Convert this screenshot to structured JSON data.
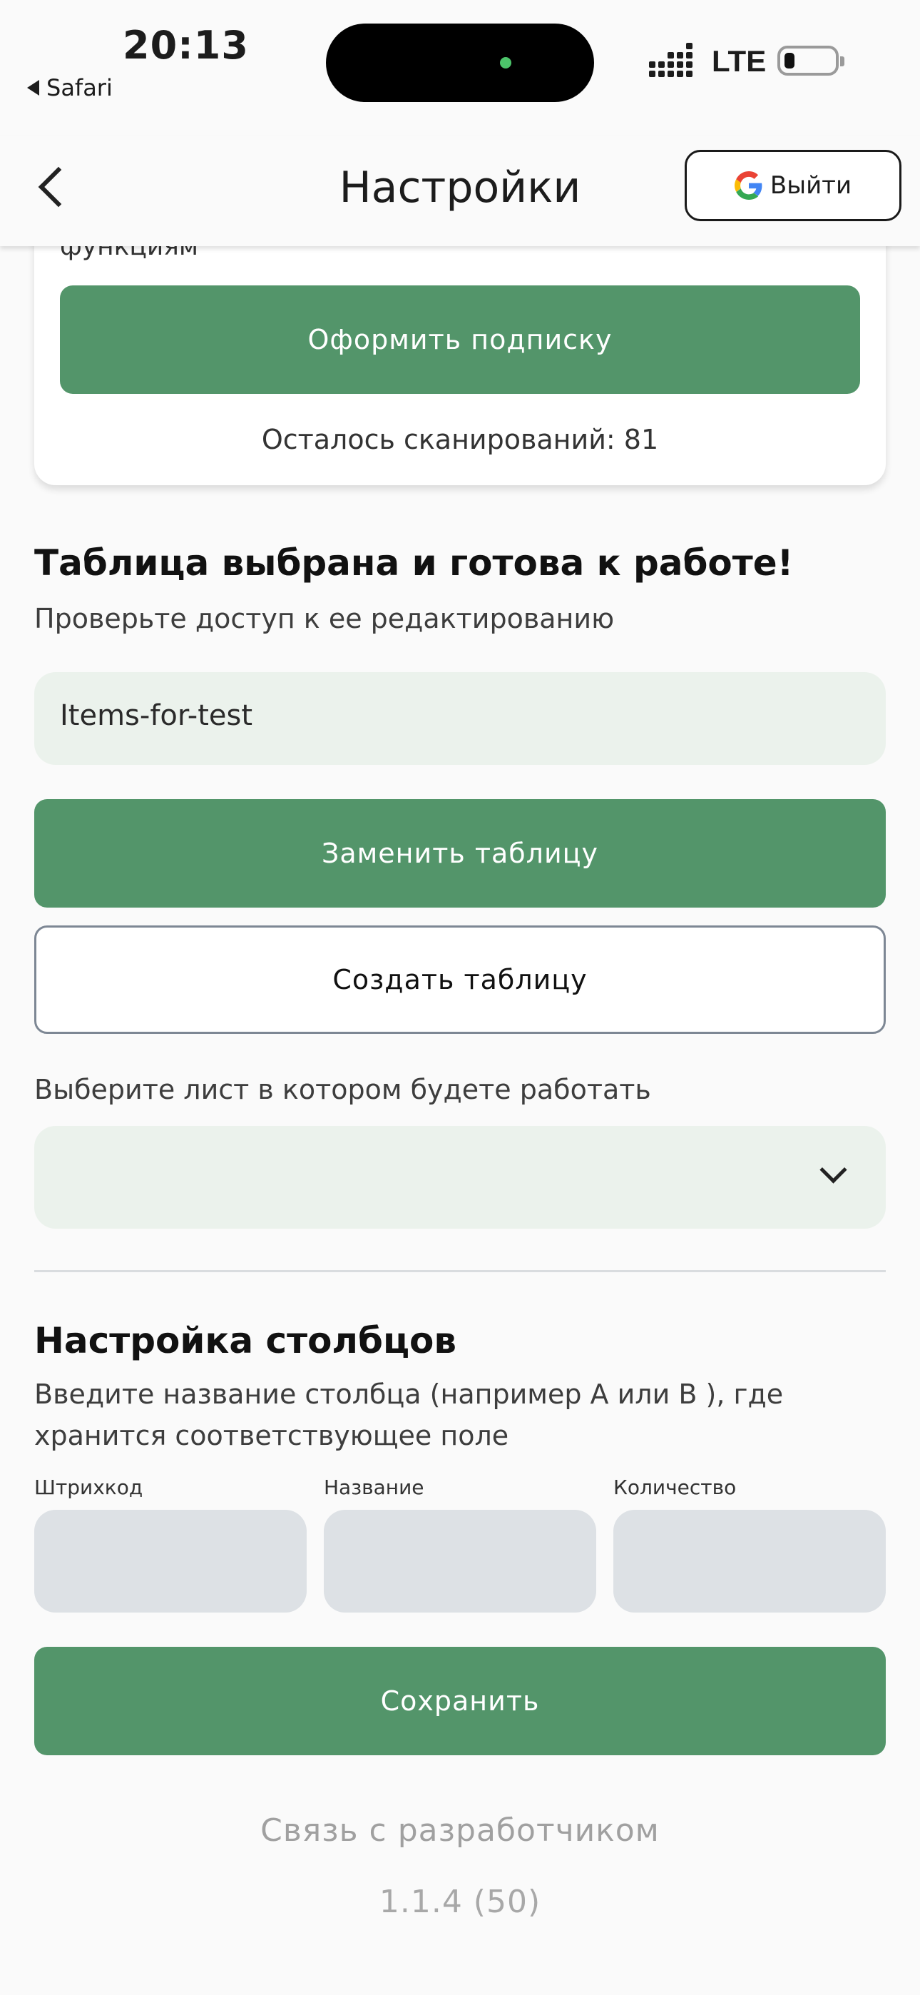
{
  "status_bar": {
    "time": "20:13",
    "back_app": "Safari",
    "network": "LTE"
  },
  "header": {
    "title": "Настройки",
    "logout_label": "Выйти",
    "logout_icon": "google-g-icon"
  },
  "subscription": {
    "cut_text": "функциям",
    "subscribe_label": "Оформить подписку",
    "scans_left": "Осталось сканирований: 81"
  },
  "table": {
    "heading": "Таблица выбрана и готова к работе!",
    "subtitle": "Проверьте доступ к ее редактированию",
    "table_name": "Items-for-test",
    "replace_label": "Заменить таблицу",
    "create_label": "Создать таблицу",
    "sheet_prompt": "Выберите лист в котором будете работать",
    "sheet_value": ""
  },
  "columns": {
    "heading": "Настройка столбцов",
    "description_line1": "Введите название столбца (например A или B ), где",
    "description_line2": "хранится соответствующее поле",
    "fields": [
      {
        "label": "Штрихкод",
        "value": ""
      },
      {
        "label": "Название",
        "value": ""
      },
      {
        "label": "Количество",
        "value": ""
      }
    ],
    "save_label": "Сохранить"
  },
  "footer": {
    "contact": "Связь с разработчиком",
    "version": "1.1.4 (50)"
  },
  "colors": {
    "accent_green": "#53956a",
    "field_bg": "#ebf2ec",
    "column_field_bg": "#dde1e5"
  }
}
